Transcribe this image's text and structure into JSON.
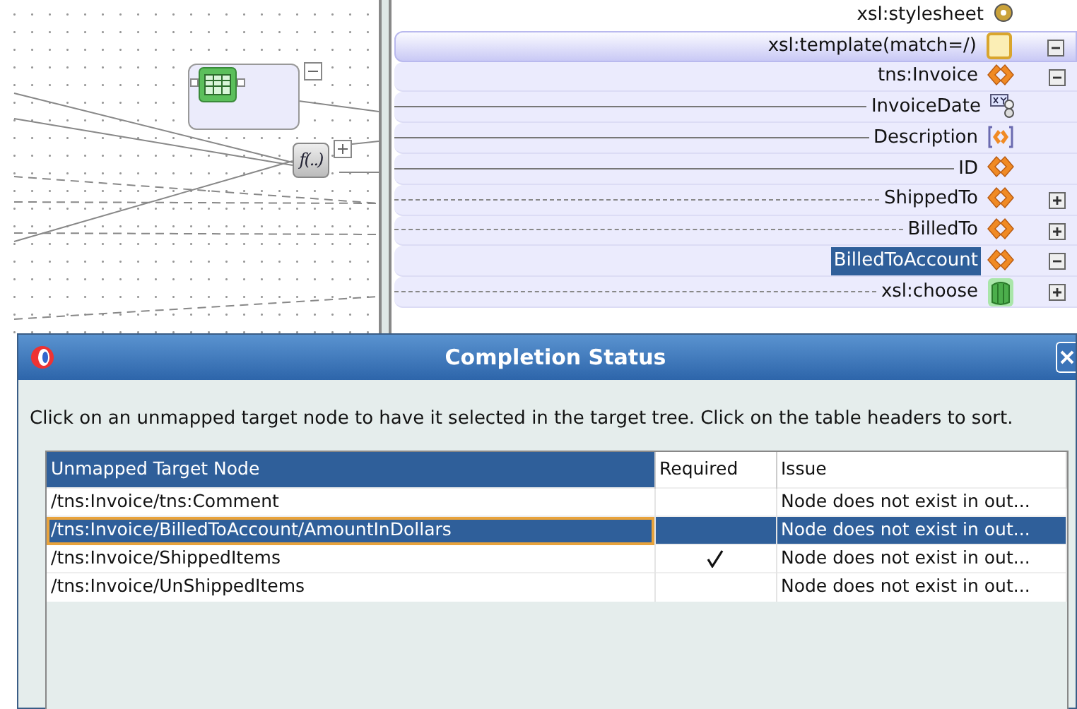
{
  "canvas": {
    "function_node": {
      "label": "f(..)"
    }
  },
  "tree": [
    {
      "label": "xsl:stylesheet",
      "kind": "stylesheet",
      "selected": false
    },
    {
      "label": "xsl:template(match=/)",
      "kind": "template",
      "expanded": true,
      "selected": false
    },
    {
      "label": "tns:Invoice",
      "kind": "element",
      "expanded": true,
      "selected": false
    },
    {
      "label": "InvoiceDate",
      "kind": "attribute",
      "mapped": true,
      "selected": false
    },
    {
      "label": "Description",
      "kind": "bracketed",
      "mapped": true,
      "selected": false
    },
    {
      "label": "ID",
      "kind": "element",
      "mapped": true,
      "selected": false
    },
    {
      "label": "ShippedTo",
      "kind": "element",
      "expanded": false,
      "mapped": false,
      "selected": false
    },
    {
      "label": "BilledTo",
      "kind": "element",
      "expanded": false,
      "mapped": false,
      "selected": false
    },
    {
      "label": "BilledToAccount",
      "kind": "element",
      "expanded": true,
      "selected": true
    },
    {
      "label": "xsl:choose",
      "kind": "choose",
      "expanded": false,
      "mapped": false,
      "selected": false
    }
  ],
  "dialog": {
    "title": "Completion Status",
    "message": "Click on an unmapped target node to have it selected in the target tree. Click on the table headers to sort.",
    "table": {
      "columns": [
        {
          "label": "Unmapped Target Node",
          "sorted": true
        },
        {
          "label": "Required",
          "sorted": false
        },
        {
          "label": "Issue",
          "sorted": false
        }
      ],
      "rows": [
        {
          "node": "/tns:Invoice/tns:Comment",
          "required": false,
          "issue": "Node does not exist in out...",
          "selected": false
        },
        {
          "node": "/tns:Invoice/BilledToAccount/AmountInDollars",
          "required": false,
          "issue": "Node does not exist in out...",
          "selected": true
        },
        {
          "node": "/tns:Invoice/ShippedItems",
          "required": true,
          "issue": "Node does not exist in out...",
          "selected": false
        },
        {
          "node": "/tns:Invoice/UnShippedItems",
          "required": false,
          "issue": "Node does not exist in out...",
          "selected": false
        }
      ]
    }
  }
}
